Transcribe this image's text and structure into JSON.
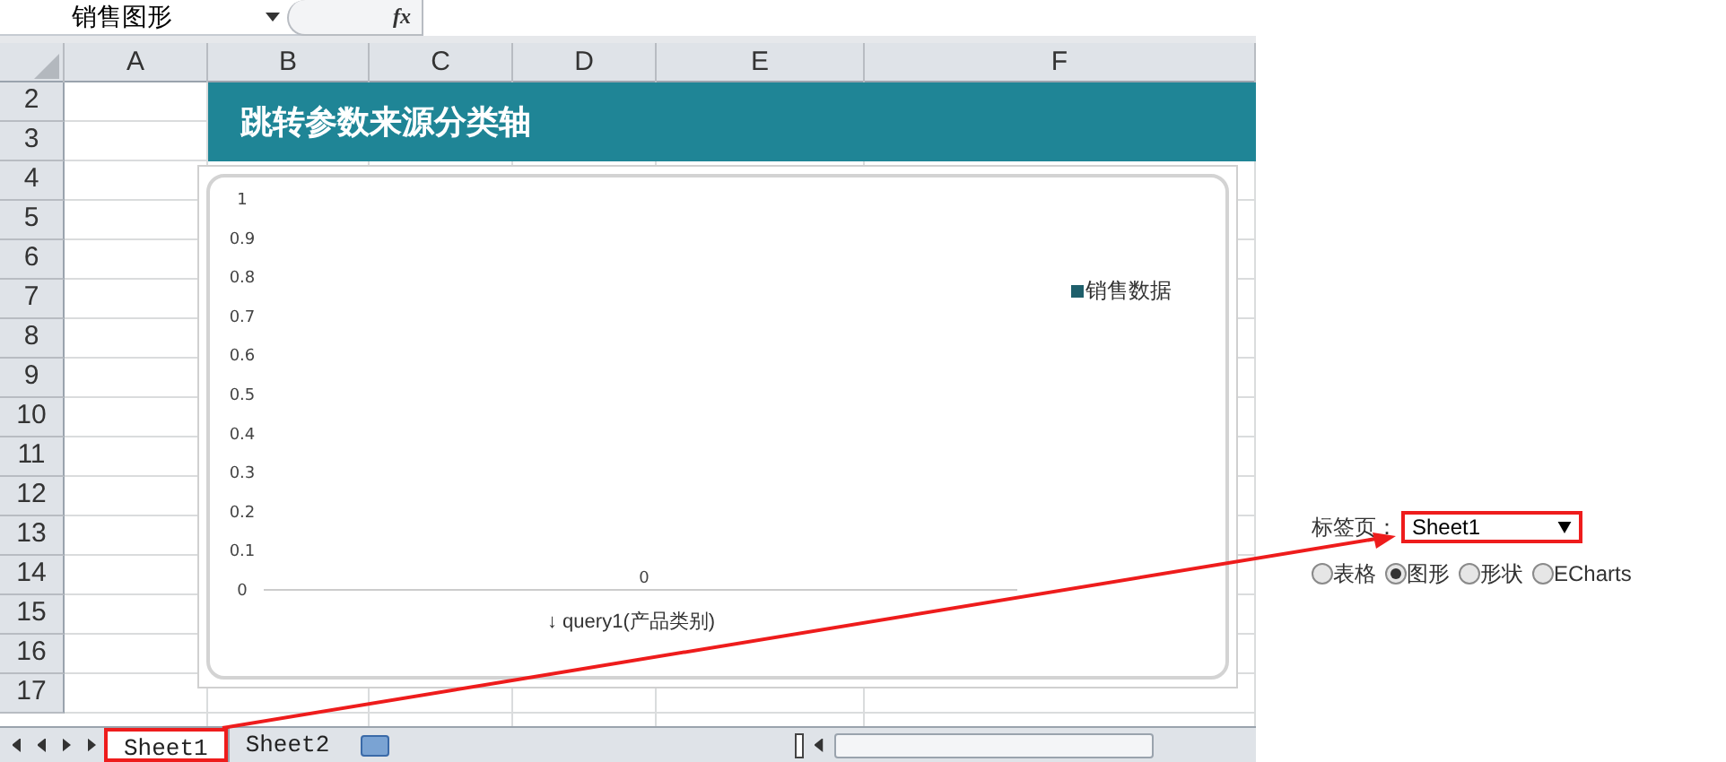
{
  "name_box": {
    "value": "销售图形"
  },
  "formula_bar": {
    "function_label": "fx"
  },
  "columns": [
    "A",
    "B",
    "C",
    "D",
    "E",
    "F"
  ],
  "rows": [
    "2",
    "3",
    "4",
    "5",
    "6",
    "7",
    "8",
    "9",
    "10",
    "11",
    "12",
    "13",
    "14",
    "15",
    "16",
    "17"
  ],
  "title_banner": "跳转参数来源分类轴",
  "chart": {
    "chart_data": {
      "type": "bar",
      "xlabel": "↓ query1(产品类别)",
      "ylim": [
        0,
        1
      ],
      "yticks": [
        0,
        0.1,
        0.2,
        0.3,
        0.4,
        0.5,
        0.6,
        0.7,
        0.8,
        0.9,
        1
      ],
      "series": [
        {
          "name": "销售数据",
          "color": "#1e5f6b",
          "values": [
            0
          ]
        }
      ],
      "data_labels": true
    }
  },
  "sheet_tabs": [
    {
      "label": "Sheet1",
      "selected": true,
      "highlighted": true
    },
    {
      "label": "Sheet2",
      "selected": false,
      "highlighted": false
    }
  ],
  "side_panel": {
    "label": "标签页：",
    "sheet_select": {
      "value": "Sheet1",
      "highlighted": true
    },
    "view_options": [
      {
        "label": "表格",
        "selected": false
      },
      {
        "label": "图形",
        "selected": true
      },
      {
        "label": "形状",
        "selected": false
      },
      {
        "label": "ECharts",
        "selected": false
      }
    ]
  }
}
